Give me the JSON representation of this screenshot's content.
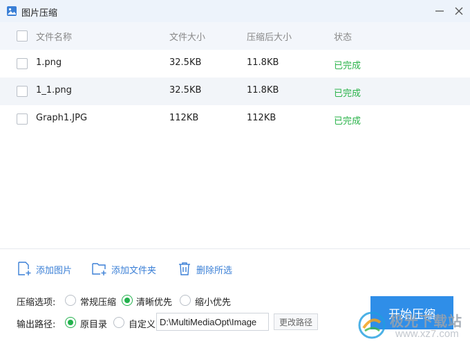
{
  "window": {
    "title": "图片压缩",
    "minimize_icon": "minimize-icon",
    "close_icon": "close-icon"
  },
  "table": {
    "columns": [
      "文件名称",
      "文件大小",
      "压缩后大小",
      "状态"
    ],
    "rows": [
      {
        "name": "1.png",
        "size": "32.5KB",
        "compressed": "11.8KB",
        "status": "已完成"
      },
      {
        "name": "1_1.png",
        "size": "32.5KB",
        "compressed": "11.8KB",
        "status": "已完成"
      },
      {
        "name": "Graph1.JPG",
        "size": "112KB",
        "compressed": "112KB",
        "status": "已完成"
      }
    ],
    "status_color": "#2ab34a"
  },
  "actions": {
    "add_image": "添加图片",
    "add_folder": "添加文件夹",
    "delete_selected": "删除所选"
  },
  "compression": {
    "label": "压缩选项:",
    "options": [
      "常规压缩",
      "清晰优先",
      "缩小优先"
    ],
    "selected": "清晰优先"
  },
  "output": {
    "label": "输出路径:",
    "options": [
      "原目录",
      "自定义"
    ],
    "selected": "原目录",
    "path_value": "D:\\MultiMediaOpt\\Image",
    "change_path_label": "更改路径"
  },
  "start_button": "开始压缩",
  "watermark": {
    "name": "极光下载站",
    "url": "www.xz7.com"
  },
  "colors": {
    "accent": "#2f8ee8",
    "link": "#3a7fd6",
    "success": "#2ab34a",
    "titlebar": "#edf3fb"
  }
}
